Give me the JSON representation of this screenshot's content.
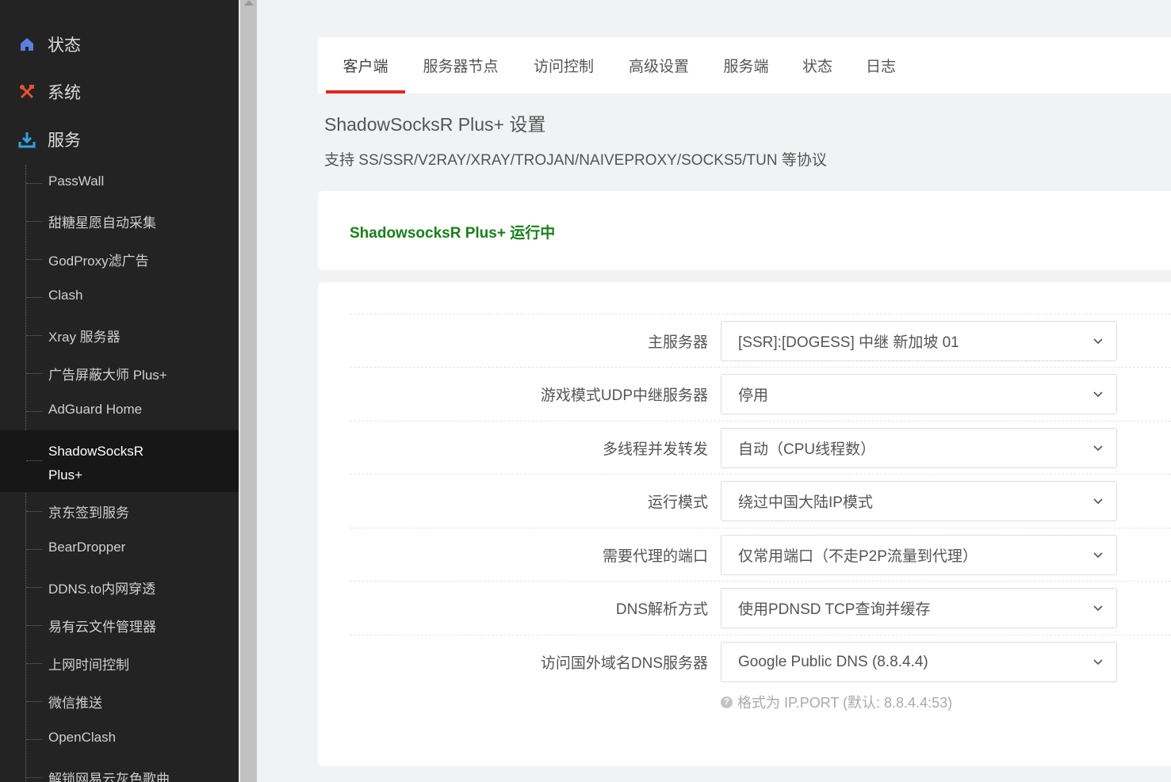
{
  "sidebar": {
    "top_items": [
      {
        "label": "状态",
        "icon": "home-icon"
      },
      {
        "label": "系统",
        "icon": "tools-icon"
      },
      {
        "label": "服务",
        "icon": "download-icon"
      }
    ],
    "sub_items": [
      "PassWall",
      "甜糖星愿自动采集",
      "GodProxy滤广告",
      "Clash",
      "Xray 服务器",
      "广告屏蔽大师 Plus+",
      "AdGuard Home",
      "ShadowSocksR Plus+",
      "京东签到服务",
      "BearDropper",
      "DDNS.to内网穿透",
      "易有云文件管理器",
      "上网时间控制",
      "微信推送",
      "OpenClash",
      "解锁网易云灰色歌曲"
    ],
    "active_sub_line1": "ShadowSocksR",
    "active_sub_line2": "Plus+"
  },
  "tabs": [
    "客户端",
    "服务器节点",
    "访问控制",
    "高级设置",
    "服务端",
    "状态",
    "日志"
  ],
  "page": {
    "title": "ShadowSocksR Plus+ 设置",
    "subtitle": "支持 SS/SSR/V2RAY/XRAY/TROJAN/NAIVEPROXY/SOCKS5/TUN 等协议",
    "status": "ShadowsocksR Plus+ 运行中"
  },
  "form": {
    "rows": [
      {
        "label": "主服务器",
        "value": "[SSR]:[DOGESS] 中继 新加坡 01"
      },
      {
        "label": "游戏模式UDP中继服务器",
        "value": "停用"
      },
      {
        "label": "多线程并发转发",
        "value": "自动（CPU线程数）"
      },
      {
        "label": "运行模式",
        "value": "绕过中国大陆IP模式"
      },
      {
        "label": "需要代理的端口",
        "value": "仅常用端口（不走P2P流量到代理）"
      },
      {
        "label": "DNS解析方式",
        "value": "使用PDNSD TCP查询并缓存"
      },
      {
        "label": "访问国外域名DNS服务器",
        "value": "Google Public DNS (8.8.4.4)"
      }
    ],
    "hint": "格式为 IP.PORT (默认: 8.8.4.4:53)",
    "hint_icon": "?"
  },
  "colors": {
    "sidebar_bg": "#232323",
    "active_tab_underline": "#e3261c",
    "status_green": "#1a7f1a",
    "home_icon": "#5b7fe0",
    "tools_icon": "#e8502f",
    "download_icon": "#2ea3e0"
  }
}
